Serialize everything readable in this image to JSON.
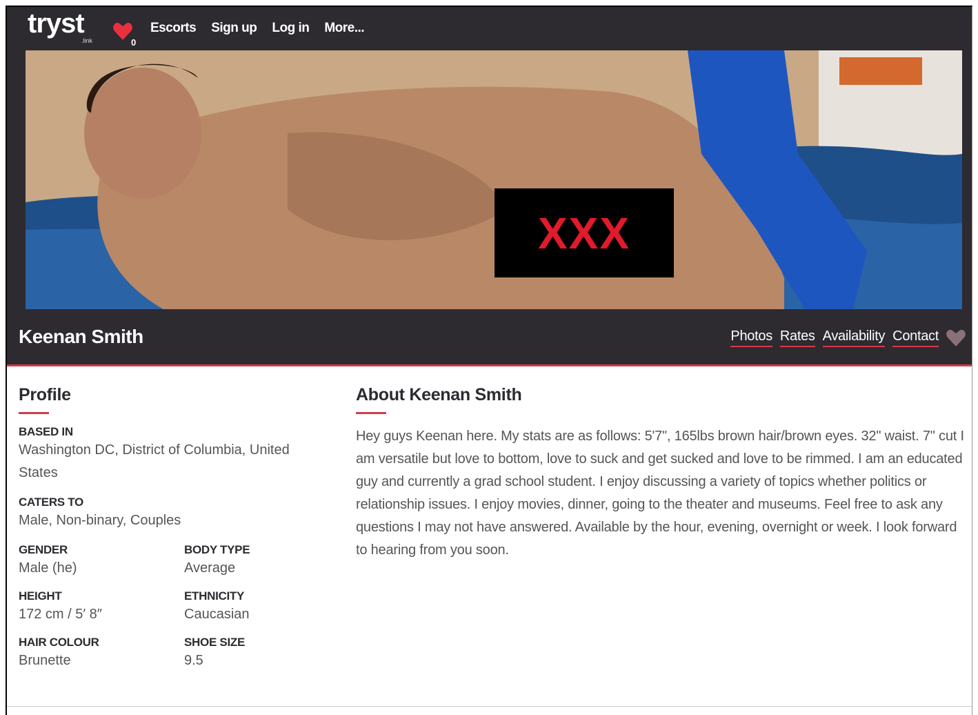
{
  "header": {
    "logo": "tryst",
    "logo_sub": ".link",
    "fav_count": "0",
    "nav": [
      "Escorts",
      "Sign up",
      "Log in",
      "More..."
    ]
  },
  "hero": {
    "censor_text": "XXX"
  },
  "profile_header": {
    "name": "Keenan Smith",
    "tabs": [
      "Photos",
      "Rates",
      "Availability",
      "Contact"
    ]
  },
  "profile": {
    "title": "Profile",
    "based_in_label": "BASED IN",
    "based_in_value": "Washington DC, District of Columbia, United States",
    "caters_to_label": "CATERS TO",
    "caters_to_value": "Male, Non-binary, Couples",
    "gender_label": "GENDER",
    "gender_value": "Male (he)",
    "body_type_label": "BODY TYPE",
    "body_type_value": "Average",
    "height_label": "HEIGHT",
    "height_value": "172 cm / 5′ 8″",
    "ethnicity_label": "ETHNICITY",
    "ethnicity_value": "Caucasian",
    "hair_label": "HAIR COLOUR",
    "hair_value": "Brunette",
    "shoe_label": "SHOE SIZE",
    "shoe_value": "9.5"
  },
  "about": {
    "title": "About Keenan Smith",
    "text": "Hey guys Keenan here. My stats are as follows: 5'7\", 165lbs brown hair/brown eyes. 32\" waist. 7\" cut I am versatile but love to bottom, love to suck and get sucked and love to be rimmed. I am an educated guy and currently a grad school student. I enjoy discussing a variety of topics whether politics or relationship issues. I enjoy movies, dinner, going to the theater and museums. Feel free to ask any questions I may not have answered. Available by the hour, evening, overnight or week. I look forward to hearing from you soon."
  },
  "colors": {
    "dark": "#2d2a30",
    "accent": "#d63a4a",
    "censor_text": "#e11a2c"
  }
}
